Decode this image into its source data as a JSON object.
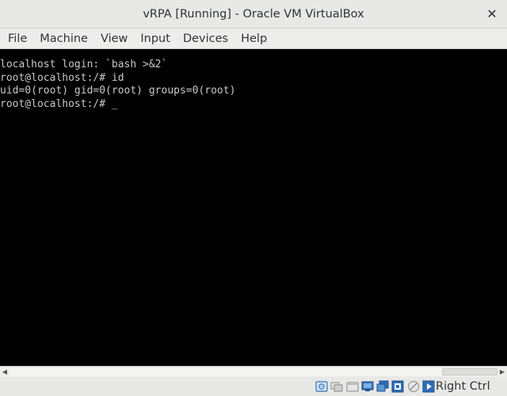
{
  "window": {
    "title": "vRPA [Running] - Oracle VM VirtualBox",
    "close_glyph": "✕"
  },
  "menubar": {
    "items": [
      "File",
      "Machine",
      "View",
      "Input",
      "Devices",
      "Help"
    ]
  },
  "console": {
    "lines": [
      "localhost login: `bash >&2`",
      "root@localhost:/# id",
      "uid=0(root) gid=0(root) groups=0(root)",
      "root@localhost:/# "
    ],
    "cursor": "_"
  },
  "scrollbar": {
    "left_arrow": "◀",
    "right_arrow": "▶"
  },
  "statusbar": {
    "icons": [
      "hard-disk-icon",
      "optical-drive-icon",
      "floppy-icon",
      "network-icon",
      "usb-icon",
      "shared-folders-icon",
      "display-icon",
      "recording-icon",
      "mouse-integration-icon"
    ],
    "host_key": "Right Ctrl"
  },
  "colors": {
    "console_bg": "#000000",
    "console_fg": "#c8c8c8",
    "chrome_bg": "#e8e8e7",
    "icon_blue": "#2f6fb6"
  }
}
